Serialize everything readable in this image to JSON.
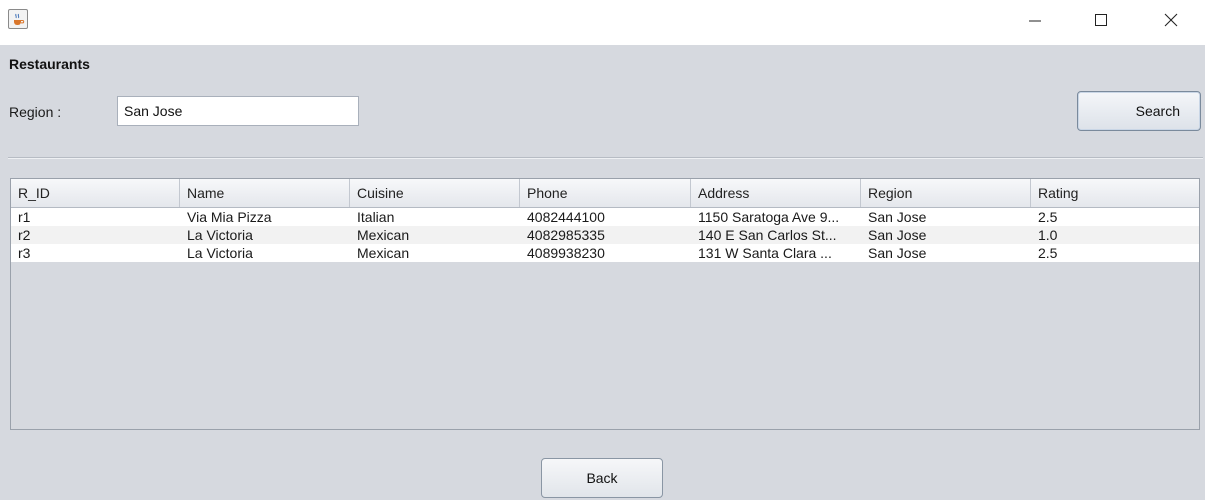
{
  "window": {
    "app_icon": "java-coffee-icon",
    "controls": {
      "minimize": "minimize-icon",
      "maximize": "maximize-icon",
      "close": "close-icon"
    }
  },
  "page": {
    "heading": "Restaurants",
    "region_label": "Region :",
    "region_value": "San Jose",
    "search_label": "Search",
    "back_label": "Back"
  },
  "table": {
    "columns": [
      "R_ID",
      "Name",
      "Cuisine",
      "Phone",
      "Address",
      "Region",
      "Rating"
    ],
    "rows": [
      [
        "r1",
        "Via Mia Pizza",
        "Italian",
        "4082444100",
        "1150 Saratoga Ave 9...",
        "San Jose",
        "2.5"
      ],
      [
        "r2",
        "La Victoria",
        "Mexican",
        "4082985335",
        "140 E San Carlos St...",
        "San Jose",
        "1.0"
      ],
      [
        "r3",
        "La Victoria",
        "Mexican",
        "4089938230",
        "131 W Santa Clara ...",
        "San Jose",
        "2.5"
      ]
    ]
  },
  "colors": {
    "panel_background": "#d6d9df",
    "row_background": "#ffffff",
    "row_alt_background": "#f2f2f2",
    "title_bar_background": "#ffffff"
  }
}
